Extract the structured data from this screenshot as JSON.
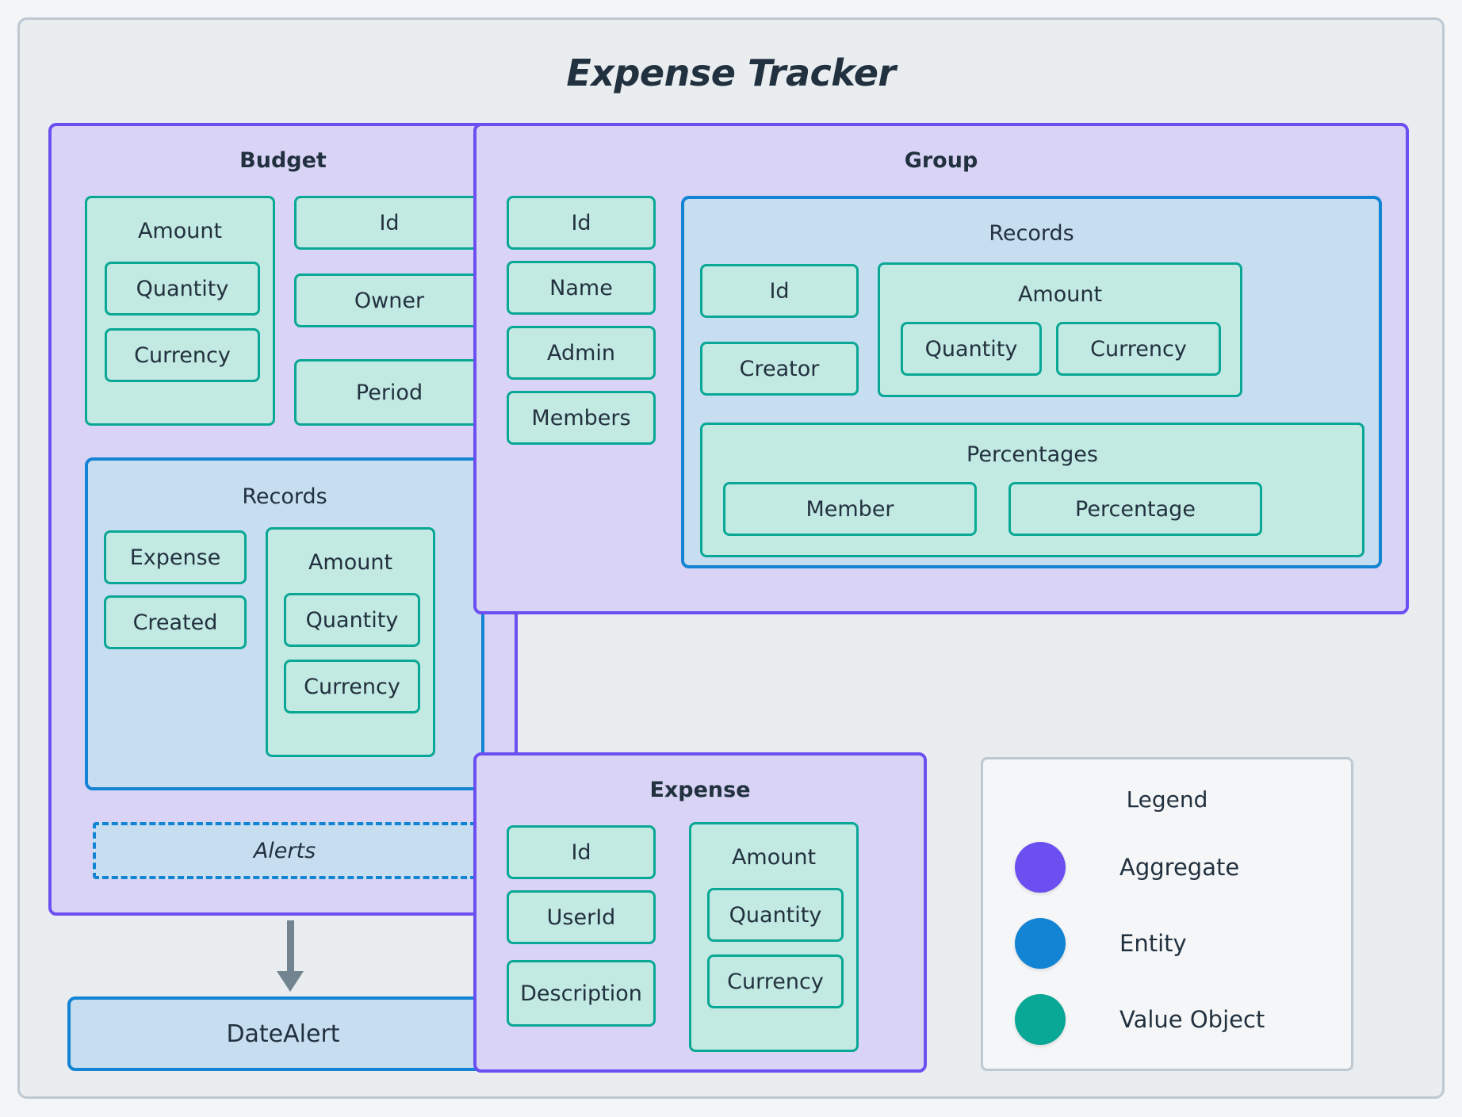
{
  "app": {
    "title": "Expense Tracker"
  },
  "colors": {
    "aggregate": "#6c4ff0",
    "entity": "#1383d3",
    "value_object": "#09a795",
    "aggregate_fill": "#d9d4f6",
    "entity_fill": "#c7ddf0",
    "value_object_fill": "#c2e9e2",
    "frame_bg": "#e9edf0",
    "text": "#22313f"
  },
  "budget": {
    "title": "Budget",
    "amount": {
      "label": "Amount",
      "fields": [
        "Quantity",
        "Currency"
      ]
    },
    "fields": [
      "Id",
      "Owner",
      "Period"
    ],
    "records": {
      "title": "Records",
      "fields": [
        "Expense",
        "Created"
      ],
      "amount": {
        "label": "Amount",
        "fields": [
          "Quantity",
          "Currency"
        ]
      }
    },
    "alerts": {
      "label": "Alerts"
    }
  },
  "date_alert": {
    "label": "DateAlert"
  },
  "group": {
    "title": "Group",
    "fields": [
      "Id",
      "Name",
      "Admin",
      "Members"
    ],
    "records": {
      "title": "Records",
      "fields": [
        "Id",
        "Creator"
      ],
      "amount": {
        "label": "Amount",
        "fields": [
          "Quantity",
          "Currency"
        ]
      },
      "percentages": {
        "label": "Percentages",
        "fields": [
          "Member",
          "Percentage"
        ]
      }
    }
  },
  "expense": {
    "title": "Expense",
    "fields": [
      "Id",
      "UserId",
      "Description"
    ],
    "amount": {
      "label": "Amount",
      "fields": [
        "Quantity",
        "Currency"
      ]
    }
  },
  "legend": {
    "title": "Legend",
    "items": [
      {
        "label": "Aggregate",
        "color": "#6c4ff0",
        "icon": "circle-icon"
      },
      {
        "label": "Entity",
        "color": "#1383d3",
        "icon": "circle-icon"
      },
      {
        "label": "Value Object",
        "color": "#09a795",
        "icon": "circle-icon"
      }
    ]
  }
}
